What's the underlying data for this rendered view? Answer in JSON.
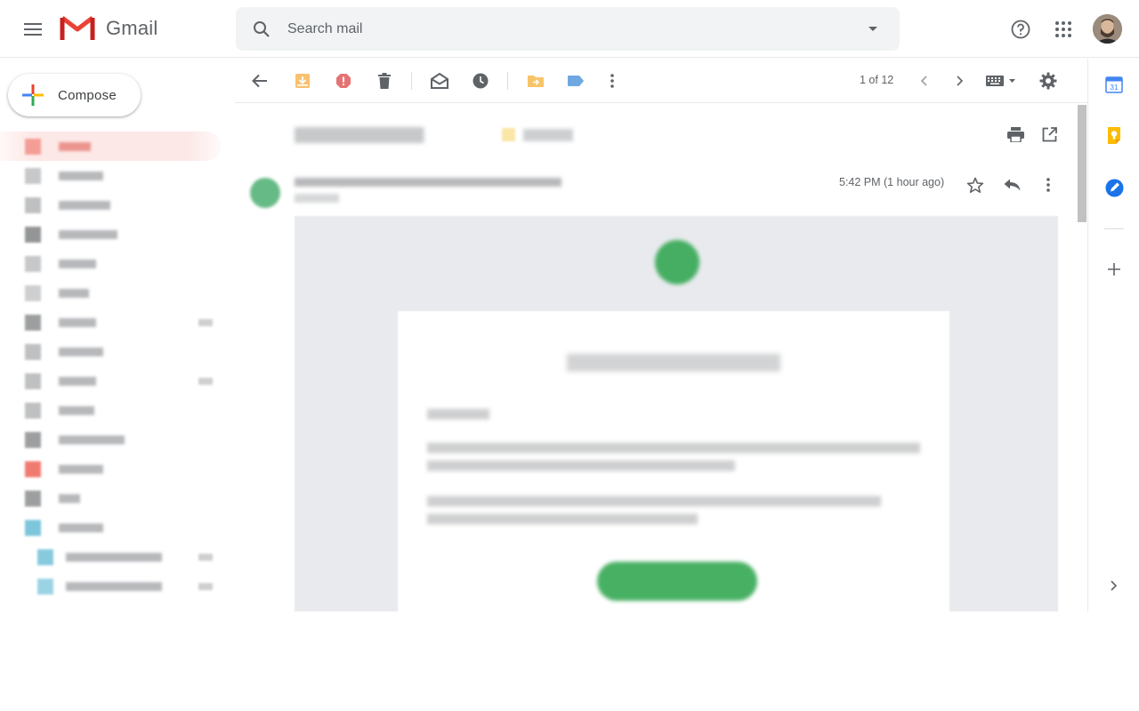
{
  "app": {
    "name": "Gmail"
  },
  "header": {
    "search_placeholder": "Search mail",
    "icons": [
      "main-menu-icon",
      "gmail-logo-icon",
      "search-icon",
      "search-options-icon",
      "help-icon",
      "apps-icon",
      "account-avatar"
    ]
  },
  "compose": {
    "label": "Compose"
  },
  "toolbar": {
    "actions": [
      "back",
      "archive",
      "report-spam",
      "delete",
      "mark-unread",
      "snooze",
      "move-to",
      "labels",
      "more"
    ],
    "pager": "1 of 12"
  },
  "message": {
    "timestamp": "5:42 PM (1 hour ago)"
  },
  "side_panel": {
    "calendar_day": "31",
    "icons": [
      "calendar-icon",
      "keep-icon",
      "tasks-icon",
      "add-icon",
      "expand-icon"
    ]
  },
  "colors": {
    "gmail_red": "#ea4335",
    "active_nav_bg": "#fce8e6",
    "brand_green": "#34a853",
    "archive_orange": "#f6b04b",
    "spam_red": "#e57373",
    "folder_yellow": "#f8c46a",
    "label_blue": "#6fa8e0"
  }
}
